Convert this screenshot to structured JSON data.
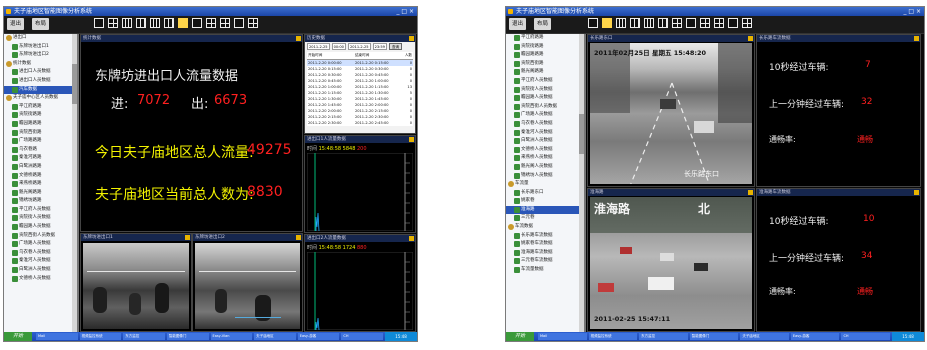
{
  "left_app": {
    "window_title": "夫子庙地区智能图像分析系统",
    "window_controls": "_ □ ×",
    "toolbar_buttons": [
      "退出",
      "布局"
    ],
    "sidebar_items": [
      {
        "label": "进出口",
        "type": "folder"
      },
      {
        "label": "东牌坊进出口1",
        "type": "cam"
      },
      {
        "label": "东牌坊进出口2",
        "type": "cam"
      },
      {
        "label": "统计数据",
        "type": "folder"
      },
      {
        "label": "进出口人员数据",
        "type": "cam"
      },
      {
        "label": "进出口人员数据",
        "type": "cam"
      },
      {
        "label": "汽车数据",
        "type": "cam",
        "selected": true
      },
      {
        "label": "夫子庙中心区人员数据",
        "type": "folder"
      },
      {
        "label": "平江府路路",
        "type": "cam"
      },
      {
        "label": "贡院街路路",
        "type": "cam"
      },
      {
        "label": "瞻园路路路",
        "type": "cam"
      },
      {
        "label": "贡院西街路",
        "type": "cam"
      },
      {
        "label": "广场路路路",
        "type": "cam"
      },
      {
        "label": "乌衣巷路",
        "type": "cam"
      },
      {
        "label": "秦淮河路路",
        "type": "cam"
      },
      {
        "label": "白鹭洲路路",
        "type": "cam"
      },
      {
        "label": "文德桥路路",
        "type": "cam"
      },
      {
        "label": "来燕桥路路",
        "type": "cam"
      },
      {
        "label": "魁光阁路路",
        "type": "cam"
      },
      {
        "label": "锦绣坊路路",
        "type": "cam"
      },
      {
        "label": "平江府人员数据",
        "type": "cam"
      },
      {
        "label": "贡院街人员数据",
        "type": "cam"
      },
      {
        "label": "瞻园路人员数据",
        "type": "cam"
      },
      {
        "label": "贡院西街人员数据",
        "type": "cam"
      },
      {
        "label": "广场路人员数据",
        "type": "cam"
      },
      {
        "label": "乌衣巷人员数据",
        "type": "cam"
      },
      {
        "label": "秦淮河人员数据",
        "type": "cam"
      },
      {
        "label": "白鹭洲人员数据",
        "type": "cam"
      },
      {
        "label": "文德桥人员数据",
        "type": "cam"
      }
    ],
    "main_panel_title": "统计数据",
    "flow_title": "东牌坊进出口人流量数据",
    "in_label": "进:",
    "in_value": "7072",
    "out_label": "出:",
    "out_value": "6673",
    "total_flow_label": "今日夫子庙地区总人流量:",
    "total_flow_value": "49275",
    "current_total_label": "夫子庙地区当前总人数为:",
    "current_total_value": "8830",
    "query_panel_title": "历史数据",
    "query_controls": [
      "2011-2-25",
      "00:00",
      "2011-2-25",
      "23:59",
      "查询"
    ],
    "table_headers": [
      "开始时间",
      "结束时间",
      "人数"
    ],
    "table_rows": [
      [
        "2011-2-20 0:00:00",
        "2011-2-20 0:15:00",
        "0"
      ],
      [
        "2011-2-20 0:15:00",
        "2011-2-20 0:30:00",
        "0"
      ],
      [
        "2011-2-20 0:30:00",
        "2011-2-20 0:45:00",
        "0"
      ],
      [
        "2011-2-20 0:45:00",
        "2011-2-20 1:00:00",
        "0"
      ],
      [
        "2011-2-20 1:00:00",
        "2011-2-20 1:15:00",
        "13"
      ],
      [
        "2011-2-20 1:15:00",
        "2011-2-20 1:30:00",
        "5"
      ],
      [
        "2011-2-20 1:30:00",
        "2011-2-20 1:45:00",
        "0"
      ],
      [
        "2011-2-20 1:45:00",
        "2011-2-20 2:00:00",
        "0"
      ],
      [
        "2011-2-20 2:00:00",
        "2011-2-20 2:15:00",
        "0"
      ],
      [
        "2011-2-20 2:15:00",
        "2011-2-20 2:30:00",
        "0"
      ],
      [
        "2011-2-20 2:30:00",
        "2011-2-20 2:45:00",
        "0"
      ]
    ],
    "chart1_title": "进出口1人流量数据",
    "chart1_time_label": "时间",
    "chart1_time": "15:48:58",
    "chart1_a": "5848",
    "chart1_b": "200",
    "chart2_title": "进出口2人流量数据",
    "chart2_time_label": "时间",
    "chart2_time": "15:48:58",
    "chart2_a": "1724",
    "chart2_b": "880",
    "video1_title": "东牌坊进出口1",
    "video2_title": "东牌坊进出口2",
    "taskbar_start": "开始",
    "taskbar_tasks": [
      "Mail",
      "视频监控系统",
      "东方监控",
      "智能图像门",
      "Easy-Vlan",
      "夫子庙地区",
      "Easy-游客",
      "CH"
    ],
    "tray_time": "15:48"
  },
  "right_app": {
    "window_title": "夫子庙地区智能图像分析系统",
    "window_controls": "_ □ ×",
    "toolbar_buttons": [
      "退出",
      "布局"
    ],
    "sidebar_items": [
      {
        "label": "平江府路路",
        "type": "cam"
      },
      {
        "label": "贡院街路路",
        "type": "cam"
      },
      {
        "label": "瞻园路路路",
        "type": "cam"
      },
      {
        "label": "贡院西街路",
        "type": "cam"
      },
      {
        "label": "魁光阁路路",
        "type": "cam"
      },
      {
        "label": "平江府人员数据",
        "type": "cam"
      },
      {
        "label": "贡院街人员数据",
        "type": "cam"
      },
      {
        "label": "瞻园路人员数据",
        "type": "cam"
      },
      {
        "label": "贡院西街人员数据",
        "type": "cam"
      },
      {
        "label": "广场路人员数据",
        "type": "cam"
      },
      {
        "label": "乌衣巷人员数据",
        "type": "cam"
      },
      {
        "label": "秦淮河人员数据",
        "type": "cam"
      },
      {
        "label": "白鹭洲人员数据",
        "type": "cam"
      },
      {
        "label": "文德桥人员数据",
        "type": "cam"
      },
      {
        "label": "来燕桥人员数据",
        "type": "cam"
      },
      {
        "label": "魁光阁人员数据",
        "type": "cam"
      },
      {
        "label": "锦绣坊人员数据",
        "type": "cam"
      },
      {
        "label": "车流量",
        "type": "folder"
      },
      {
        "label": "长乐路东口",
        "type": "cam"
      },
      {
        "label": "姚家巷",
        "type": "cam"
      },
      {
        "label": "淮海路",
        "type": "cam",
        "selected": true
      },
      {
        "label": "三元巷",
        "type": "cam"
      },
      {
        "label": "车流数据",
        "type": "folder"
      },
      {
        "label": "长乐路车流数据",
        "type": "cam"
      },
      {
        "label": "姚家巷车流数据",
        "type": "cam"
      },
      {
        "label": "淮海路车流数据",
        "type": "cam"
      },
      {
        "label": "三元巷车流数据",
        "type": "cam"
      },
      {
        "label": "车流量数据",
        "type": "cam"
      }
    ],
    "cam1_title": "长乐路东口",
    "cam1_osd_date": "2011年02月25日 星期五 15:48:20",
    "cam1_osd_place": "长乐路东口",
    "cam2_title": "淮海路",
    "cam2_osd_place": "淮海路",
    "cam2_osd_char": "北",
    "cam2_osd_date": "2011-02-25 15:47:11",
    "stats1_title": "长乐路车流数据",
    "stats2_title": "淮海路车流数据",
    "s1_label1": "10秒经过车辆:",
    "s1_val1": "7",
    "s1_label2": "上一分钟经过车辆:",
    "s1_val2": "32",
    "s1_label3": "通畅率:",
    "s1_val3": "通畅",
    "s2_label1": "10秒经过车辆:",
    "s2_val1": "10",
    "s2_label2": "上一分钟经过车辆:",
    "s2_val2": "34",
    "s2_label3": "通畅率:",
    "s2_val3": "通畅",
    "taskbar_start": "开始",
    "taskbar_tasks": [
      "Mail",
      "视频监控系统",
      "东方监控",
      "智能图像门",
      "夫子庙地区",
      "Easy-游客",
      "CH"
    ],
    "tray_time": "15:48"
  },
  "colors": {
    "accent_yellow": "#f2f200",
    "value_red": "#ff2020",
    "osd_red": "#e01010",
    "title_blue": "#1b46a8"
  }
}
